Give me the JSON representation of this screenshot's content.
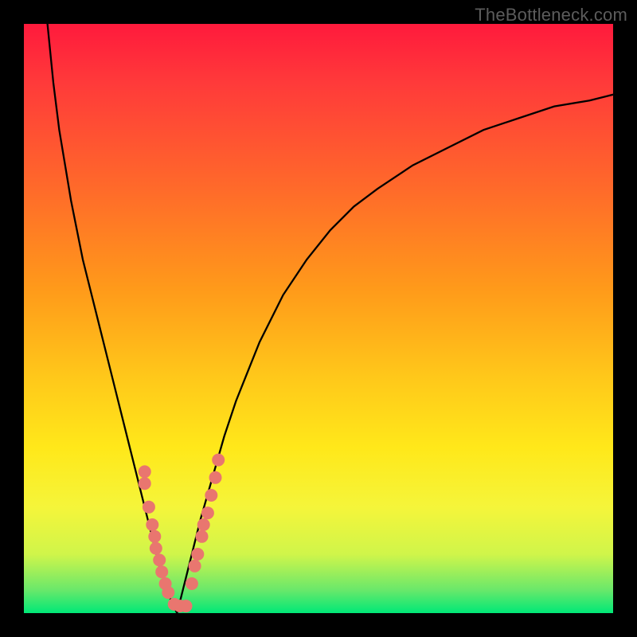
{
  "watermark": "TheBottleneck.com",
  "chart_data": {
    "type": "line",
    "title": "",
    "xlabel": "",
    "ylabel": "",
    "xlim": [
      0,
      100
    ],
    "ylim": [
      0,
      100
    ],
    "series": [
      {
        "name": "left-curve",
        "x": [
          4,
          5,
          6,
          7,
          8,
          9,
          10,
          11,
          12,
          13,
          14,
          15,
          16,
          17,
          18,
          19,
          20,
          21,
          22,
          23,
          24,
          25,
          26
        ],
        "y": [
          100,
          90,
          82,
          76,
          70,
          65,
          60,
          56,
          52,
          48,
          44,
          40,
          36,
          32,
          28,
          24,
          20,
          16,
          12,
          8,
          5,
          2,
          0
        ]
      },
      {
        "name": "right-curve",
        "x": [
          26,
          27,
          28,
          29,
          30,
          32,
          34,
          36,
          38,
          40,
          44,
          48,
          52,
          56,
          60,
          66,
          72,
          78,
          84,
          90,
          96,
          100
        ],
        "y": [
          0,
          4,
          8,
          12,
          16,
          23,
          30,
          36,
          41,
          46,
          54,
          60,
          65,
          69,
          72,
          76,
          79,
          82,
          84,
          86,
          87,
          88
        ]
      }
    ],
    "markers": {
      "name": "fit-markers",
      "color": "#e9766f",
      "points": [
        {
          "x": 20.5,
          "y": 24
        },
        {
          "x": 20.5,
          "y": 22
        },
        {
          "x": 21.2,
          "y": 18
        },
        {
          "x": 21.8,
          "y": 15
        },
        {
          "x": 22.2,
          "y": 13
        },
        {
          "x": 22.4,
          "y": 11
        },
        {
          "x": 23.0,
          "y": 9
        },
        {
          "x": 23.4,
          "y": 7
        },
        {
          "x": 24.0,
          "y": 5
        },
        {
          "x": 24.5,
          "y": 3.5
        },
        {
          "x": 25.5,
          "y": 1.5
        },
        {
          "x": 26.5,
          "y": 1.2
        },
        {
          "x": 27.5,
          "y": 1.2
        },
        {
          "x": 28.5,
          "y": 5
        },
        {
          "x": 29.0,
          "y": 8
        },
        {
          "x": 29.5,
          "y": 10
        },
        {
          "x": 30.2,
          "y": 13
        },
        {
          "x": 30.5,
          "y": 15
        },
        {
          "x": 31.2,
          "y": 17
        },
        {
          "x": 31.8,
          "y": 20
        },
        {
          "x": 32.5,
          "y": 23
        },
        {
          "x": 33.0,
          "y": 26
        }
      ]
    },
    "gradient_stops": [
      {
        "pos": 0,
        "color": "#ff1a3c"
      },
      {
        "pos": 10,
        "color": "#ff3a3a"
      },
      {
        "pos": 28,
        "color": "#ff6a2a"
      },
      {
        "pos": 45,
        "color": "#ff9a1a"
      },
      {
        "pos": 60,
        "color": "#ffc81a"
      },
      {
        "pos": 72,
        "color": "#ffe81a"
      },
      {
        "pos": 82,
        "color": "#f5f53a"
      },
      {
        "pos": 90,
        "color": "#d0f54a"
      },
      {
        "pos": 96,
        "color": "#6be86a"
      },
      {
        "pos": 100,
        "color": "#00e877"
      }
    ]
  }
}
